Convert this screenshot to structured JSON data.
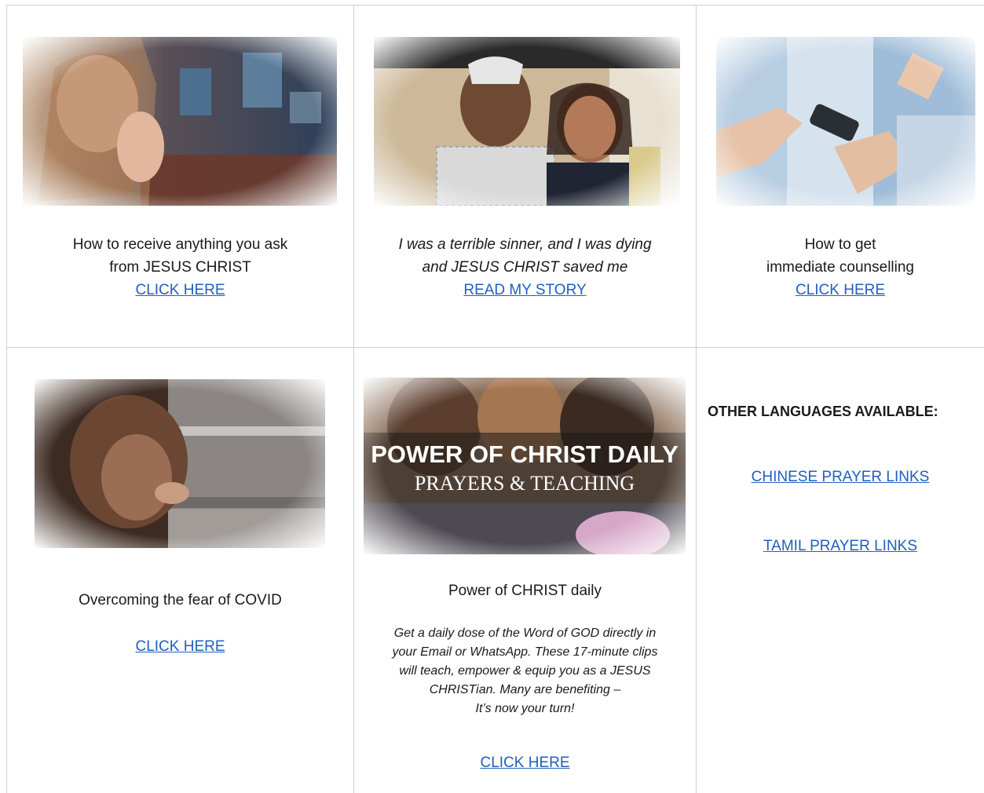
{
  "cards": [
    {
      "title_line1": "How to receive anything you ask",
      "title_line2": "from JESUS CHRIST",
      "link": "CLICK HERE"
    },
    {
      "title_line1": "I was a terrible sinner, and I was dying",
      "title_line2": "and JESUS CHRIST saved me",
      "link": "READ MY STORY"
    },
    {
      "title_line1": "How to get",
      "title_line2": "immediate counselling",
      "link": "CLICK HERE"
    },
    {
      "title_line1": "Overcoming the fear of COVID",
      "link": "CLICK HERE"
    },
    {
      "banner_line1": "POWER OF CHRIST DAILY",
      "banner_line2": "PRAYERS & TEACHING",
      "title_line1": "Power of CHRIST daily",
      "desc_lines": [
        "Get a daily dose of the Word of GOD directly in",
        "your Email or WhatsApp. These 17-minute clips",
        "will teach, empower & equip you as a JESUS",
        "CHRISTian. Many are benefiting –",
        "It’s now your turn!"
      ],
      "link": "CLICK HERE"
    }
  ],
  "languages": {
    "heading": "OTHER LANGUAGES AVAILABLE:",
    "links": [
      "CHINESE PRAYER LINKS",
      "TAMIL PRAYER LINKS"
    ]
  },
  "colors": {
    "link": "#1f5fbf",
    "border": "#cfcfcf"
  }
}
